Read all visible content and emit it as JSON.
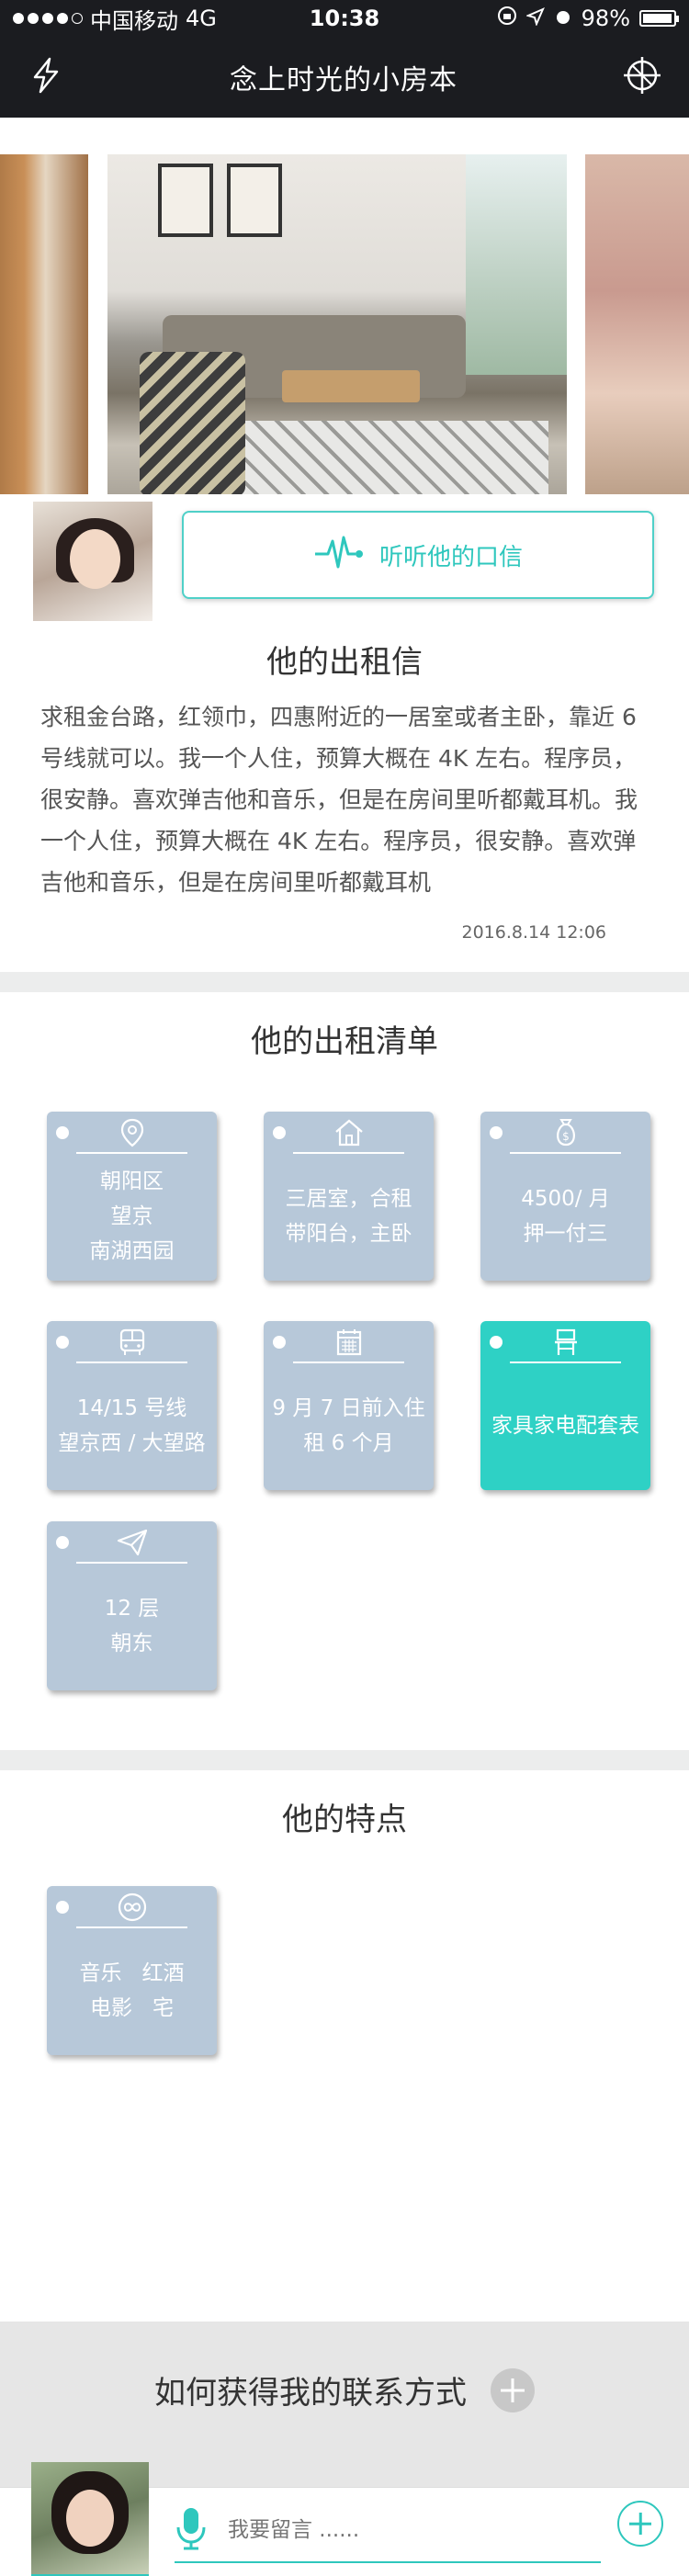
{
  "status_bar": {
    "carrier": "中国移动",
    "network": "4G",
    "time": "10:38",
    "battery": "98%",
    "battery_level": 0.98
  },
  "navbar": {
    "title": "念上时光的小房本"
  },
  "intro": {
    "voice_label": "听听他的口信",
    "letter_title": "他的出租信",
    "letter_body": "求租金台路，红领巾，四惠附近的一居室或者主卧，靠近 6 号线就可以。我一个人住，预算大概在 4K 左右。程序员，很安静。喜欢弹吉他和音乐，但是在房间里听都戴耳机。我一个人住，预算大概在 4K 左右。程序员，很安静。喜欢弹吉他和音乐，但是在房间里听都戴耳机",
    "letter_date": "2016.8.14 12:06"
  },
  "rental_list": {
    "title": "他的出租清单",
    "cards": [
      {
        "icon": "location-pin-icon",
        "lines": [
          "朝阳区",
          "望京",
          "南湖西园"
        ]
      },
      {
        "icon": "house-icon",
        "lines": [
          "三居室，合租",
          "带阳台，主卧"
        ]
      },
      {
        "icon": "money-bag-icon",
        "lines": [
          "4500/ 月",
          "押一付三"
        ]
      },
      {
        "icon": "bus-icon",
        "lines": [
          "14/15 号线",
          "望京西 / 大望路"
        ]
      },
      {
        "icon": "calendar-icon",
        "lines": [
          "9 月 7 日前入住",
          "租 6 个月"
        ]
      },
      {
        "icon": "chair-icon",
        "lines": [
          "家具家电配套表"
        ]
      },
      {
        "icon": "paper-plane-icon",
        "lines": [
          "12 层",
          "朝东"
        ]
      }
    ]
  },
  "features": {
    "title": "他的特点",
    "card": {
      "icon": "infinity-icon",
      "lines": [
        "音乐   红酒",
        "电影   宅"
      ]
    }
  },
  "contact": {
    "title": "如何获得我的联系方式"
  },
  "message": {
    "placeholder": "我要留言 ......"
  },
  "colors": {
    "accent": "#2ec7bd",
    "card": "#b7c8d9",
    "dark": "#1b1c20"
  }
}
